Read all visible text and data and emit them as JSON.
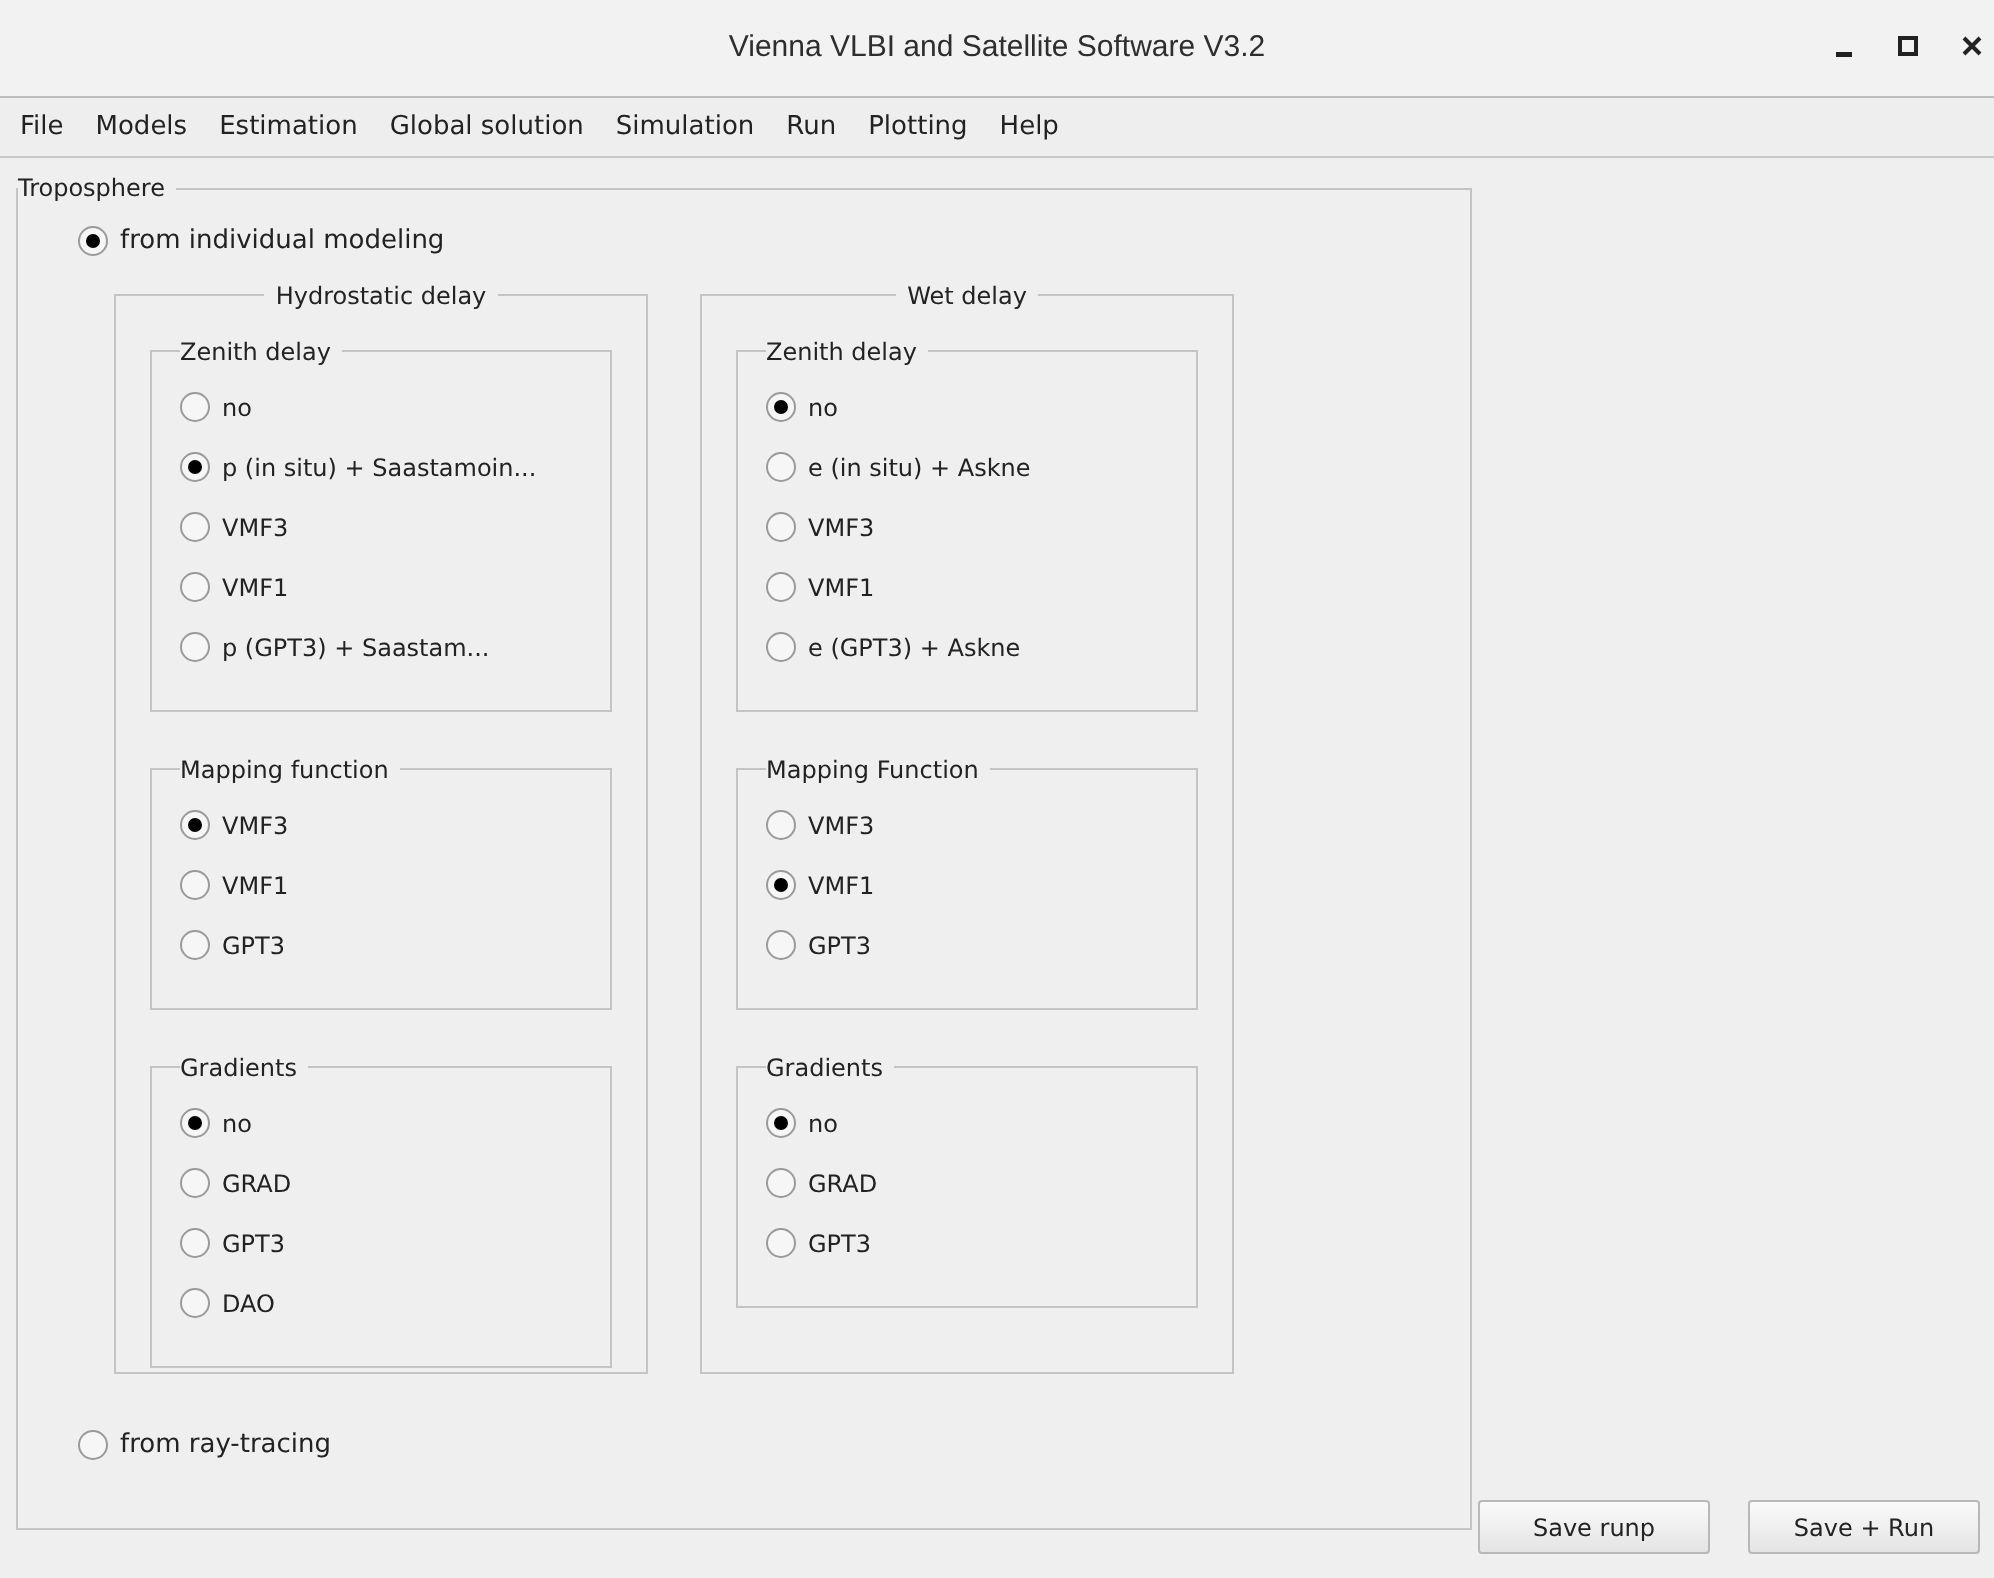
{
  "window": {
    "title": "Vienna VLBI and Satellite Software V3.2"
  },
  "menu": [
    "File",
    "Models",
    "Estimation",
    "Global solution",
    "Simulation",
    "Run",
    "Plotting",
    "Help"
  ],
  "troposphere": {
    "title": "Troposphere",
    "modes": [
      {
        "label": "from individual modeling",
        "selected": true
      },
      {
        "label": "from ray-tracing",
        "selected": false
      }
    ],
    "panels": [
      {
        "title": "Hydrostatic delay",
        "groups": [
          {
            "title": "Zenith delay",
            "options": [
              {
                "label": "no",
                "selected": false
              },
              {
                "label": "p (in situ) + Saastamoin...",
                "selected": true
              },
              {
                "label": "VMF3",
                "selected": false
              },
              {
                "label": "VMF1",
                "selected": false
              },
              {
                "label": "p (GPT3) + Saastam...",
                "selected": false
              }
            ]
          },
          {
            "title": "Mapping function",
            "options": [
              {
                "label": "VMF3",
                "selected": true
              },
              {
                "label": "VMF1",
                "selected": false
              },
              {
                "label": "GPT3",
                "selected": false
              }
            ]
          },
          {
            "title": "Gradients",
            "options": [
              {
                "label": "no",
                "selected": true
              },
              {
                "label": "GRAD",
                "selected": false
              },
              {
                "label": "GPT3",
                "selected": false
              },
              {
                "label": "DAO",
                "selected": false
              }
            ]
          }
        ]
      },
      {
        "title": "Wet delay",
        "groups": [
          {
            "title": "Zenith delay",
            "options": [
              {
                "label": "no",
                "selected": true
              },
              {
                "label": "e (in situ) + Askne",
                "selected": false
              },
              {
                "label": "VMF3",
                "selected": false
              },
              {
                "label": "VMF1",
                "selected": false
              },
              {
                "label": "e (GPT3) + Askne",
                "selected": false
              }
            ]
          },
          {
            "title": "Mapping Function",
            "options": [
              {
                "label": "VMF3",
                "selected": false
              },
              {
                "label": "VMF1",
                "selected": true
              },
              {
                "label": "GPT3",
                "selected": false
              }
            ]
          },
          {
            "title": "Gradients",
            "options": [
              {
                "label": "no",
                "selected": true
              },
              {
                "label": "GRAD",
                "selected": false
              },
              {
                "label": "GPT3",
                "selected": false
              }
            ]
          }
        ]
      }
    ]
  },
  "buttons": [
    "Save runp",
    "Save + Run"
  ]
}
